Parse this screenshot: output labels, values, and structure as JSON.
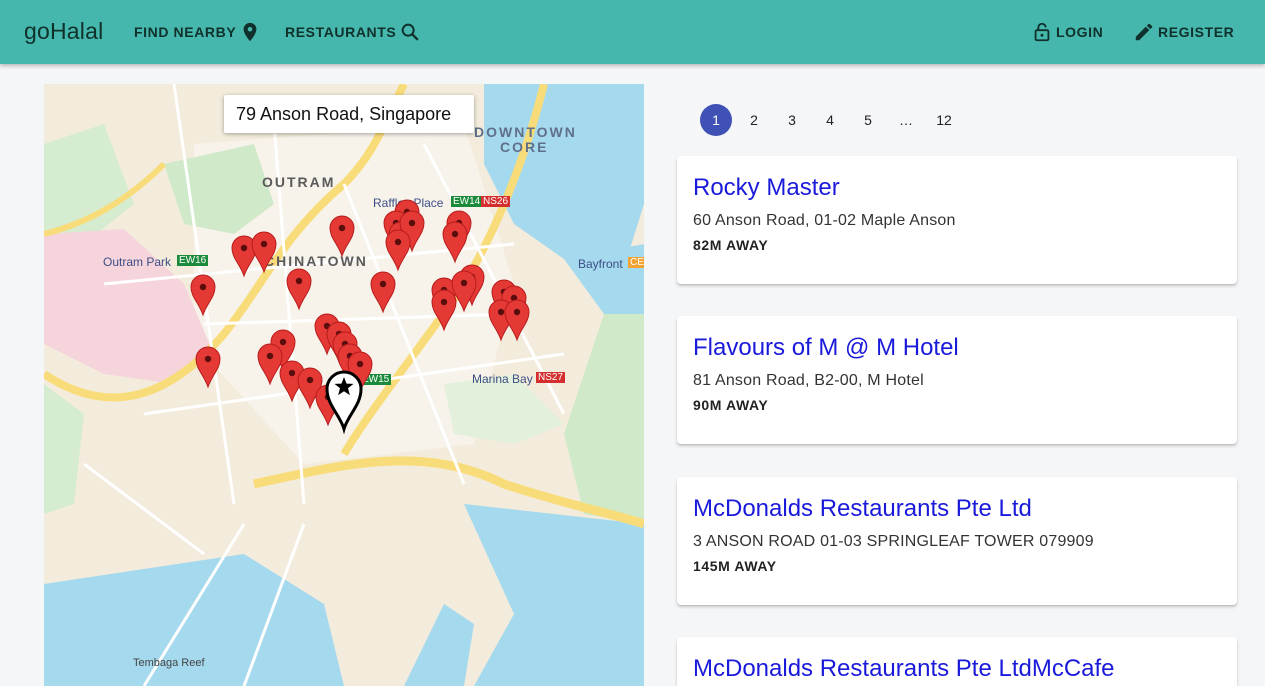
{
  "header": {
    "brand": "goHalal",
    "nav": [
      {
        "label": "FIND NEARBY",
        "icon": "location-pin-icon"
      },
      {
        "label": "RESTAURANTS",
        "icon": "search-icon"
      }
    ],
    "auth": [
      {
        "label": "LOGIN",
        "icon": "lock-icon"
      },
      {
        "label": "REGISTER",
        "icon": "pencil-icon"
      }
    ]
  },
  "map": {
    "search_value": "79 Anson Road, Singapore",
    "labels": {
      "downtown_core_1": "DOWNTOWN",
      "downtown_core_2": "CORE",
      "outram": "OUTRAM",
      "chinatown": "CHINATOWN",
      "raffles_place": "Raffles Place",
      "ew14": "EW14",
      "ns26": "NS26",
      "outram_park": "Outram Park",
      "ew16": "EW16",
      "bayfront": "Bayfront",
      "ce": "CE",
      "marina_bay": "Marina Bay",
      "ns27": "NS27",
      "ew15": "EW15",
      "tembaga_reef": "Tembaga Reef"
    }
  },
  "pagination": {
    "pages": [
      "1",
      "2",
      "3",
      "4",
      "5",
      "…",
      "12"
    ],
    "active": "1"
  },
  "results": [
    {
      "name": "Rocky Master",
      "address": "60 Anson Road, 01-02 Maple Anson",
      "distance": "82M AWAY"
    },
    {
      "name": "Flavours of M @ M Hotel",
      "address": "81 Anson Road, B2-00, M Hotel",
      "distance": "90M AWAY"
    },
    {
      "name": "McDonalds Restaurants Pte Ltd",
      "address": "3 ANSON ROAD 01-03 SPRINGLEAF TOWER 079909",
      "distance": "145M AWAY"
    },
    {
      "name": "McDonalds Restaurants Pte LtdMcCafe",
      "address": "",
      "distance": ""
    }
  ],
  "colors": {
    "appbar": "#45b7ac",
    "link": "#1a1adb",
    "page_active": "#3f51b5",
    "marker": "#e53935",
    "water": "#a5d9ee"
  }
}
